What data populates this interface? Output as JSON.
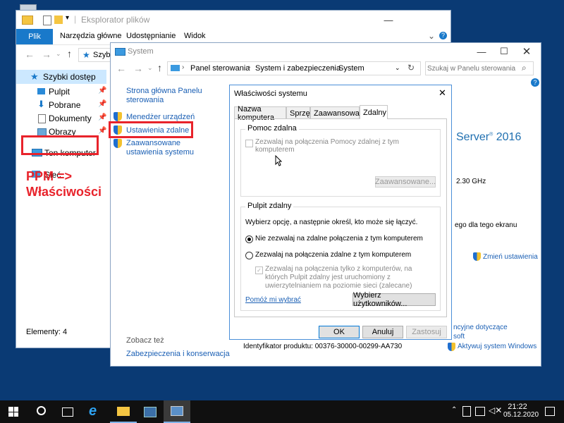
{
  "explorer": {
    "title": "Eksplorator plików",
    "ribbon_tabs": [
      "Plik",
      "Narzędzia główne",
      "Udostępnianie",
      "Widok"
    ],
    "address_fragment": "Szyb",
    "nav_items": [
      "Szybki dostęp",
      "Pulpit",
      "Pobrane",
      "Dokumenty",
      "Obrazy",
      "Ten komputer",
      "Sieć"
    ],
    "status": "Elementy: 4"
  },
  "annotation": {
    "line1": "PPM =>",
    "line2": "Właściwości",
    "color": "#e8232b"
  },
  "system": {
    "title": "System",
    "breadcrumb": [
      "Panel sterowania",
      "System i zabezpieczenia",
      "System"
    ],
    "search_placeholder": "Szukaj w Panelu sterowania",
    "left_links": {
      "home": "Strona główna Panelu sterowania",
      "device_manager": "Menedżer urządzeń",
      "remote": "Ustawienia zdalne",
      "advanced": "Zaawansowane ustawienia systemu"
    },
    "see_also": "Zobacz też",
    "security": "Zabezpieczenia i konserwacja",
    "server_text": "Server",
    "server_year": "2016",
    "cpu": "2.30 GHz",
    "display": "ego dla tego ekranu",
    "change_settings": "Zmień ustawienia",
    "license1": "ncyjne dotyczące",
    "license2": "soft",
    "product_id": "Identyfikator produktu: 00376-30000-00299-AA730",
    "activate": "Aktywuj system Windows"
  },
  "dialog": {
    "title": "Właściwości systemu",
    "tabs": [
      "Nazwa komputera",
      "Sprzęt",
      "Zaawansowane",
      "Zdalny"
    ],
    "assist_group": "Pomoc zdalna",
    "assist_checkbox": "Zezwalaj na połączenia Pomocy zdalnej z tym komputerem",
    "assist_advanced": "Zaawansowane...",
    "desktop_group": "Pulpit zdalny",
    "desktop_desc": "Wybierz opcję, a następnie określ, kto może się łączyć.",
    "radio1": "Nie zezwalaj na zdalne połączenia z tym komputerem",
    "radio2": "Zezwalaj na połączenia zdalne z tym komputerem",
    "nla": "Zezwalaj na połączenia tylko z komputerów, na których Pulpit zdalny jest uruchomiony z uwierzytelnianiem na poziomie sieci (zalecane)",
    "help_link": "Pomóż mi wybrać",
    "select_users": "Wybierz użytkowników...",
    "ok": "OK",
    "cancel": "Anuluj",
    "apply": "Zastosuj"
  },
  "taskbar": {
    "time": "21:22",
    "date": "05.12.2020"
  }
}
